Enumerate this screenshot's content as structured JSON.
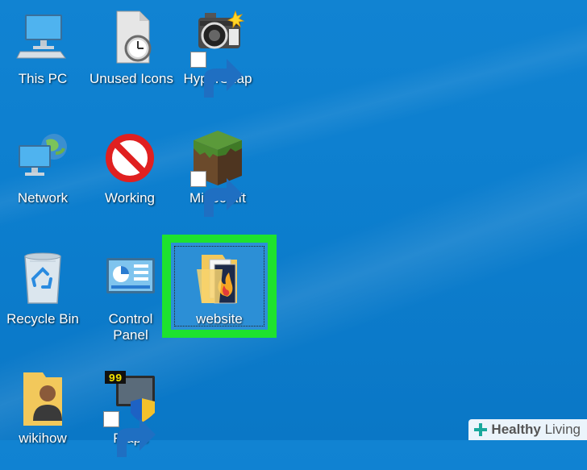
{
  "desktop": {
    "icons": [
      {
        "label": "This PC",
        "icon": "this-pc-icon"
      },
      {
        "label": "Unused Icons",
        "icon": "file-clock-icon"
      },
      {
        "label": "HyperSnap",
        "icon": "hypersnap-camera-icon"
      },
      {
        "label": "Network",
        "icon": "network-globe-icon"
      },
      {
        "label": "Working",
        "icon": "no-sign-icon"
      },
      {
        "label": "Minecraft",
        "icon": "minecraft-grass-block-icon"
      },
      {
        "label": "Recycle Bin",
        "icon": "recycle-bin-icon"
      },
      {
        "label": "Control\nPanel",
        "icon": "control-panel-icon"
      },
      {
        "label": "website",
        "icon": "folder-icon"
      },
      {
        "label": "wikihow",
        "icon": "user-folder-icon"
      },
      {
        "label": "Fraps",
        "icon": "fraps-icon"
      }
    ],
    "selected": "website",
    "highlight_color": "#1ee22e"
  },
  "watermark": {
    "brand": "Healthy",
    "brand2": "Living"
  }
}
